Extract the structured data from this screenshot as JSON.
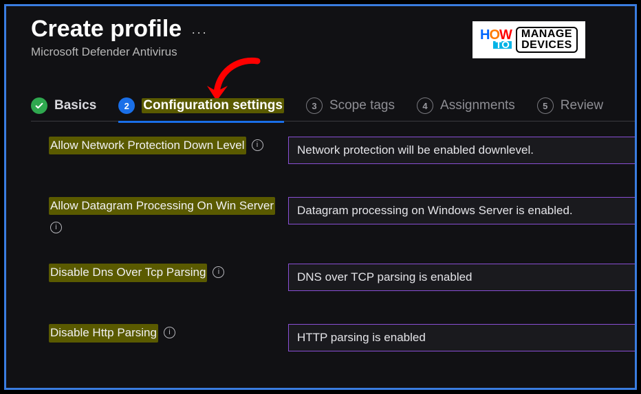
{
  "header": {
    "title": "Create profile",
    "subtitle": "Microsoft Defender Antivirus",
    "more_menu": "···"
  },
  "watermark": {
    "line1": "HOW",
    "line2": "TO",
    "box_line1": "MANAGE",
    "box_line2": "DEVICES"
  },
  "tabs": [
    {
      "num": "",
      "label": "Basics",
      "state": "done"
    },
    {
      "num": "2",
      "label": "Configuration settings",
      "state": "active"
    },
    {
      "num": "3",
      "label": "Scope tags",
      "state": "pending"
    },
    {
      "num": "4",
      "label": "Assignments",
      "state": "pending"
    },
    {
      "num": "5",
      "label": "Review",
      "state": "pending"
    }
  ],
  "settings": [
    {
      "label": "Allow Network Protection Down Level",
      "value": "Network protection will be enabled downlevel."
    },
    {
      "label": "Allow Datagram Processing On Win Server",
      "value": "Datagram processing on Windows Server is enabled."
    },
    {
      "label": "Disable Dns Over Tcp Parsing",
      "value": "DNS over TCP parsing is enabled"
    },
    {
      "label": "Disable Http Parsing",
      "value": "HTTP parsing is enabled"
    }
  ],
  "icons": {
    "info_glyph": "i"
  }
}
